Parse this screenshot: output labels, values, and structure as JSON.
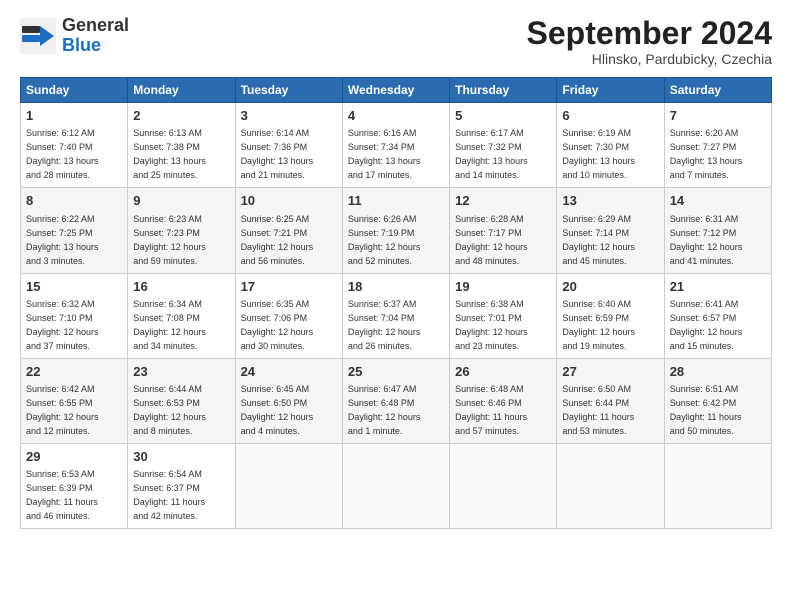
{
  "header": {
    "logo_general": "General",
    "logo_blue": "Blue",
    "month_title": "September 2024",
    "subtitle": "Hlinsko, Pardubicky, Czechia"
  },
  "days_of_week": [
    "Sunday",
    "Monday",
    "Tuesday",
    "Wednesday",
    "Thursday",
    "Friday",
    "Saturday"
  ],
  "weeks": [
    [
      {
        "day": "1",
        "info": "Sunrise: 6:12 AM\nSunset: 7:40 PM\nDaylight: 13 hours\nand 28 minutes."
      },
      {
        "day": "2",
        "info": "Sunrise: 6:13 AM\nSunset: 7:38 PM\nDaylight: 13 hours\nand 25 minutes."
      },
      {
        "day": "3",
        "info": "Sunrise: 6:14 AM\nSunset: 7:36 PM\nDaylight: 13 hours\nand 21 minutes."
      },
      {
        "day": "4",
        "info": "Sunrise: 6:16 AM\nSunset: 7:34 PM\nDaylight: 13 hours\nand 17 minutes."
      },
      {
        "day": "5",
        "info": "Sunrise: 6:17 AM\nSunset: 7:32 PM\nDaylight: 13 hours\nand 14 minutes."
      },
      {
        "day": "6",
        "info": "Sunrise: 6:19 AM\nSunset: 7:30 PM\nDaylight: 13 hours\nand 10 minutes."
      },
      {
        "day": "7",
        "info": "Sunrise: 6:20 AM\nSunset: 7:27 PM\nDaylight: 13 hours\nand 7 minutes."
      }
    ],
    [
      {
        "day": "8",
        "info": "Sunrise: 6:22 AM\nSunset: 7:25 PM\nDaylight: 13 hours\nand 3 minutes."
      },
      {
        "day": "9",
        "info": "Sunrise: 6:23 AM\nSunset: 7:23 PM\nDaylight: 12 hours\nand 59 minutes."
      },
      {
        "day": "10",
        "info": "Sunrise: 6:25 AM\nSunset: 7:21 PM\nDaylight: 12 hours\nand 56 minutes."
      },
      {
        "day": "11",
        "info": "Sunrise: 6:26 AM\nSunset: 7:19 PM\nDaylight: 12 hours\nand 52 minutes."
      },
      {
        "day": "12",
        "info": "Sunrise: 6:28 AM\nSunset: 7:17 PM\nDaylight: 12 hours\nand 48 minutes."
      },
      {
        "day": "13",
        "info": "Sunrise: 6:29 AM\nSunset: 7:14 PM\nDaylight: 12 hours\nand 45 minutes."
      },
      {
        "day": "14",
        "info": "Sunrise: 6:31 AM\nSunset: 7:12 PM\nDaylight: 12 hours\nand 41 minutes."
      }
    ],
    [
      {
        "day": "15",
        "info": "Sunrise: 6:32 AM\nSunset: 7:10 PM\nDaylight: 12 hours\nand 37 minutes."
      },
      {
        "day": "16",
        "info": "Sunrise: 6:34 AM\nSunset: 7:08 PM\nDaylight: 12 hours\nand 34 minutes."
      },
      {
        "day": "17",
        "info": "Sunrise: 6:35 AM\nSunset: 7:06 PM\nDaylight: 12 hours\nand 30 minutes."
      },
      {
        "day": "18",
        "info": "Sunrise: 6:37 AM\nSunset: 7:04 PM\nDaylight: 12 hours\nand 26 minutes."
      },
      {
        "day": "19",
        "info": "Sunrise: 6:38 AM\nSunset: 7:01 PM\nDaylight: 12 hours\nand 23 minutes."
      },
      {
        "day": "20",
        "info": "Sunrise: 6:40 AM\nSunset: 6:59 PM\nDaylight: 12 hours\nand 19 minutes."
      },
      {
        "day": "21",
        "info": "Sunrise: 6:41 AM\nSunset: 6:57 PM\nDaylight: 12 hours\nand 15 minutes."
      }
    ],
    [
      {
        "day": "22",
        "info": "Sunrise: 6:42 AM\nSunset: 6:55 PM\nDaylight: 12 hours\nand 12 minutes."
      },
      {
        "day": "23",
        "info": "Sunrise: 6:44 AM\nSunset: 6:53 PM\nDaylight: 12 hours\nand 8 minutes."
      },
      {
        "day": "24",
        "info": "Sunrise: 6:45 AM\nSunset: 6:50 PM\nDaylight: 12 hours\nand 4 minutes."
      },
      {
        "day": "25",
        "info": "Sunrise: 6:47 AM\nSunset: 6:48 PM\nDaylight: 12 hours\nand 1 minute."
      },
      {
        "day": "26",
        "info": "Sunrise: 6:48 AM\nSunset: 6:46 PM\nDaylight: 11 hours\nand 57 minutes."
      },
      {
        "day": "27",
        "info": "Sunrise: 6:50 AM\nSunset: 6:44 PM\nDaylight: 11 hours\nand 53 minutes."
      },
      {
        "day": "28",
        "info": "Sunrise: 6:51 AM\nSunset: 6:42 PM\nDaylight: 11 hours\nand 50 minutes."
      }
    ],
    [
      {
        "day": "29",
        "info": "Sunrise: 6:53 AM\nSunset: 6:39 PM\nDaylight: 11 hours\nand 46 minutes."
      },
      {
        "day": "30",
        "info": "Sunrise: 6:54 AM\nSunset: 6:37 PM\nDaylight: 11 hours\nand 42 minutes."
      },
      {
        "day": "",
        "info": ""
      },
      {
        "day": "",
        "info": ""
      },
      {
        "day": "",
        "info": ""
      },
      {
        "day": "",
        "info": ""
      },
      {
        "day": "",
        "info": ""
      }
    ]
  ]
}
